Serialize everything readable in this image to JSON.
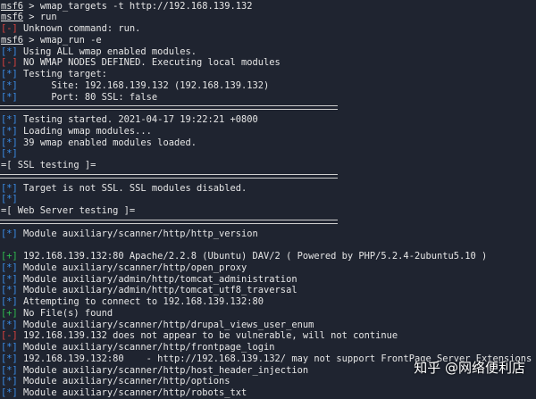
{
  "colors": {
    "background": "#1f2430",
    "info": "#3b8eea",
    "error": "#e0443e",
    "success": "#2fbf4f",
    "text": "#e6e6e6"
  },
  "prompt": {
    "name": "msf6",
    "gt": " > "
  },
  "tags": {
    "info": "[*]",
    "error": "[-]",
    "success": "[+]"
  },
  "lines": [
    {
      "kind": "prompt",
      "text": "wmap_targets -t http://192.168.139.132"
    },
    {
      "kind": "prompt",
      "text": "run"
    },
    {
      "kind": "error",
      "text": "Unknown command: run."
    },
    {
      "kind": "prompt",
      "text": "wmap_run -e"
    },
    {
      "kind": "info",
      "text": "Using ALL wmap enabled modules."
    },
    {
      "kind": "error",
      "text": "NO WMAP NODES DEFINED. Executing local modules"
    },
    {
      "kind": "info",
      "text": "Testing target:"
    },
    {
      "kind": "info",
      "text": "     Site: 192.168.139.132 (192.168.139.132)"
    },
    {
      "kind": "info",
      "text": "     Port: 80 SSL: false"
    },
    {
      "kind": "sep"
    },
    {
      "kind": "info",
      "text": "Testing started. 2021-04-17 19:22:21 +0800"
    },
    {
      "kind": "info",
      "text": "Loading wmap modules..."
    },
    {
      "kind": "info",
      "text": "39 wmap enabled modules loaded."
    },
    {
      "kind": "info",
      "text": ""
    },
    {
      "kind": "plain",
      "text": "=[ SSL testing ]="
    },
    {
      "kind": "sep"
    },
    {
      "kind": "info",
      "text": "Target is not SSL. SSL modules disabled."
    },
    {
      "kind": "info",
      "text": ""
    },
    {
      "kind": "plain",
      "text": "=[ Web Server testing ]="
    },
    {
      "kind": "sep"
    },
    {
      "kind": "info",
      "text": "Module auxiliary/scanner/http/http_version"
    },
    {
      "kind": "blank"
    },
    {
      "kind": "success",
      "text": "192.168.139.132:80 Apache/2.2.8 (Ubuntu) DAV/2 ( Powered by PHP/5.2.4-2ubuntu5.10 )"
    },
    {
      "kind": "info",
      "text": "Module auxiliary/scanner/http/open_proxy"
    },
    {
      "kind": "info",
      "text": "Module auxiliary/admin/http/tomcat_administration"
    },
    {
      "kind": "info",
      "text": "Module auxiliary/admin/http/tomcat_utf8_traversal"
    },
    {
      "kind": "info",
      "text": "Attempting to connect to 192.168.139.132:80"
    },
    {
      "kind": "success",
      "text": "No File(s) found"
    },
    {
      "kind": "info",
      "text": "Module auxiliary/scanner/http/drupal_views_user_enum"
    },
    {
      "kind": "error",
      "text": "192.168.139.132 does not appear to be vulnerable, will not continue"
    },
    {
      "kind": "info",
      "text": "Module auxiliary/scanner/http/frontpage_login"
    },
    {
      "kind": "info",
      "text": "192.168.139.132:80    - http://192.168.139.132/ may not support FrontPage Server Extensions"
    },
    {
      "kind": "info",
      "text": "Module auxiliary/scanner/http/host_header_injection"
    },
    {
      "kind": "info",
      "text": "Module auxiliary/scanner/http/options"
    },
    {
      "kind": "info",
      "text": "Module auxiliary/scanner/http/robots_txt"
    }
  ],
  "watermark": "知乎 @网络便利店"
}
